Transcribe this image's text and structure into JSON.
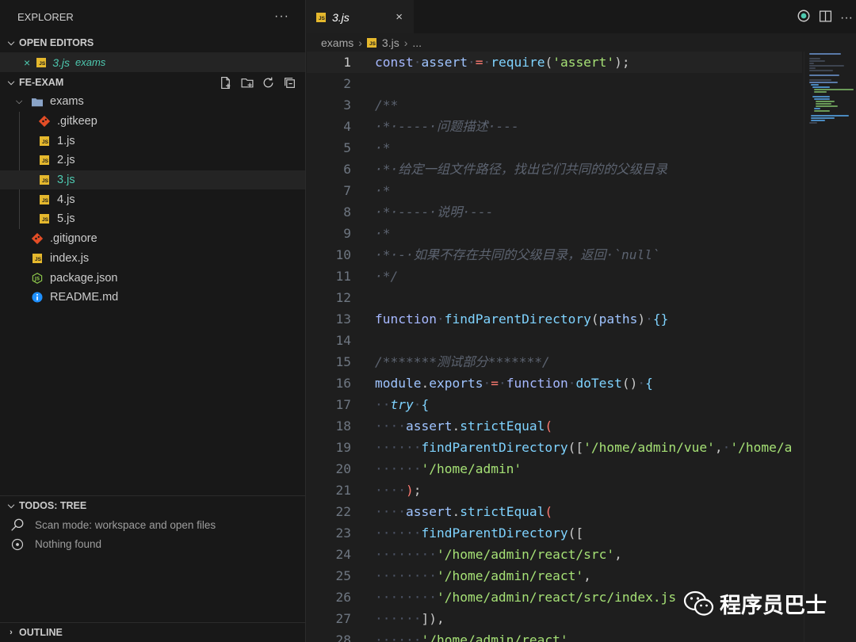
{
  "sidebar": {
    "title": "EXPLORER",
    "more": "···",
    "open_editors": {
      "label": "OPEN EDITORS",
      "items": [
        {
          "close": "×",
          "name": "3.js",
          "dir": "exams"
        }
      ]
    },
    "project": {
      "label": "FE-EXAM",
      "tree": [
        {
          "name": "exams",
          "type": "folder",
          "level": 1
        },
        {
          "name": ".gitkeep",
          "type": "git",
          "level": 2
        },
        {
          "name": "1.js",
          "type": "js",
          "level": 2
        },
        {
          "name": "2.js",
          "type": "js",
          "level": 2
        },
        {
          "name": "3.js",
          "type": "js",
          "level": 2,
          "active": true
        },
        {
          "name": "4.js",
          "type": "js",
          "level": 2
        },
        {
          "name": "5.js",
          "type": "js",
          "level": 2
        },
        {
          "name": ".gitignore",
          "type": "git",
          "level": 1
        },
        {
          "name": "index.js",
          "type": "js",
          "level": 1
        },
        {
          "name": "package.json",
          "type": "json",
          "level": 1
        },
        {
          "name": "README.md",
          "type": "info",
          "level": 1
        }
      ]
    },
    "todos": {
      "label": "TODOS: TREE",
      "scan_mode": "Scan mode: workspace and open files",
      "nothing": "Nothing found"
    },
    "outline": {
      "label": "OUTLINE"
    }
  },
  "editor": {
    "tab": {
      "label": "3.js",
      "close": "×"
    },
    "breadcrumb": {
      "folder": "exams",
      "file": "3.js",
      "more": "..."
    },
    "current_line": 1
  },
  "colors": {
    "accent": "#4ec9b0",
    "js_icon": "#e5b82d",
    "git_icon": "#e44d26",
    "json_icon": "#8bc34a",
    "info_icon": "#1e90ff"
  },
  "watermark": {
    "text": "程序员巴士"
  }
}
